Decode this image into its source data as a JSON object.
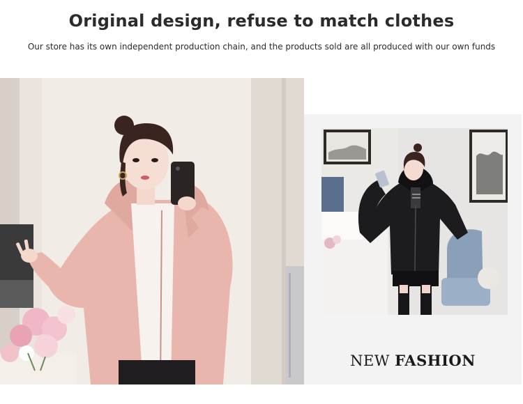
{
  "header": {
    "title": "Original design, refuse to match clothes",
    "subtitle": "Our store has its own independent production chain, and the products sold are all produced with our own funds"
  },
  "caption": {
    "word1": "NEW",
    "word2": "FASHION"
  },
  "colors": {
    "pink_coat": "#e8b6ad",
    "black_coat": "#1c1c1e"
  }
}
